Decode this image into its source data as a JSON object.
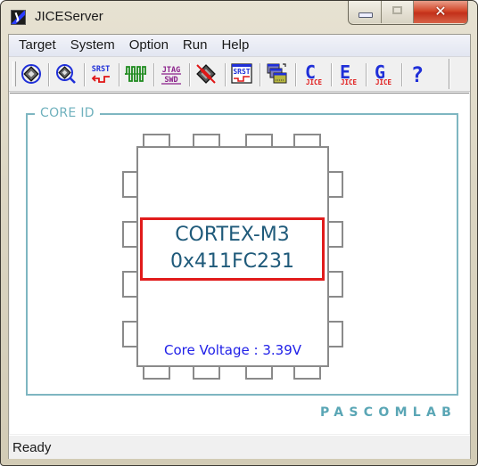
{
  "window": {
    "title": "JICEServer",
    "controls": {
      "minimize": "minimize",
      "maximize": "maximize",
      "close": "✕"
    }
  },
  "menu": [
    "Target",
    "System",
    "Option",
    "Run",
    "Help"
  ],
  "toolbar": [
    {
      "id": "connect",
      "icon": "chip-target-icon",
      "tooltip_label": ""
    },
    {
      "id": "search",
      "icon": "chip-search-icon"
    },
    {
      "id": "srst",
      "icon": "srst-reset-icon",
      "text": "SRST"
    },
    {
      "id": "signal",
      "icon": "signal-waveform-icon"
    },
    {
      "id": "jtag-swd",
      "icon": "jtag-swd-icon",
      "text_top": "JTAG",
      "text_bottom": "SWD"
    },
    {
      "id": "disconnect",
      "icon": "chip-disconnect-icon"
    },
    {
      "id": "srst-config",
      "icon": "srst-window-icon",
      "text": "SRST"
    },
    {
      "id": "multi",
      "icon": "multi-window-icon"
    },
    {
      "id": "c-jice",
      "icon": "c-jice-icon",
      "letter": "C",
      "sub": "JICE"
    },
    {
      "id": "e-jice",
      "icon": "e-jice-icon",
      "letter": "E",
      "sub": "JICE"
    },
    {
      "id": "g-jice",
      "icon": "g-jice-icon",
      "letter": "G",
      "sub": "JICE"
    },
    {
      "id": "help",
      "icon": "help-icon",
      "letter": "?"
    }
  ],
  "core": {
    "group_label": "CORE ID",
    "core_name": "CORTEX-M3",
    "core_id": "0x411FC231",
    "voltage_text": "Core Voltage : 3.39V"
  },
  "brand": "PASCOMLAB",
  "status": "Ready",
  "colors": {
    "group_border": "#7eb6c1",
    "highlight_box": "#e11b1b",
    "core_text": "#1f5a7a",
    "voltage_text": "#2020e8",
    "brand": "#5aa6b5"
  }
}
